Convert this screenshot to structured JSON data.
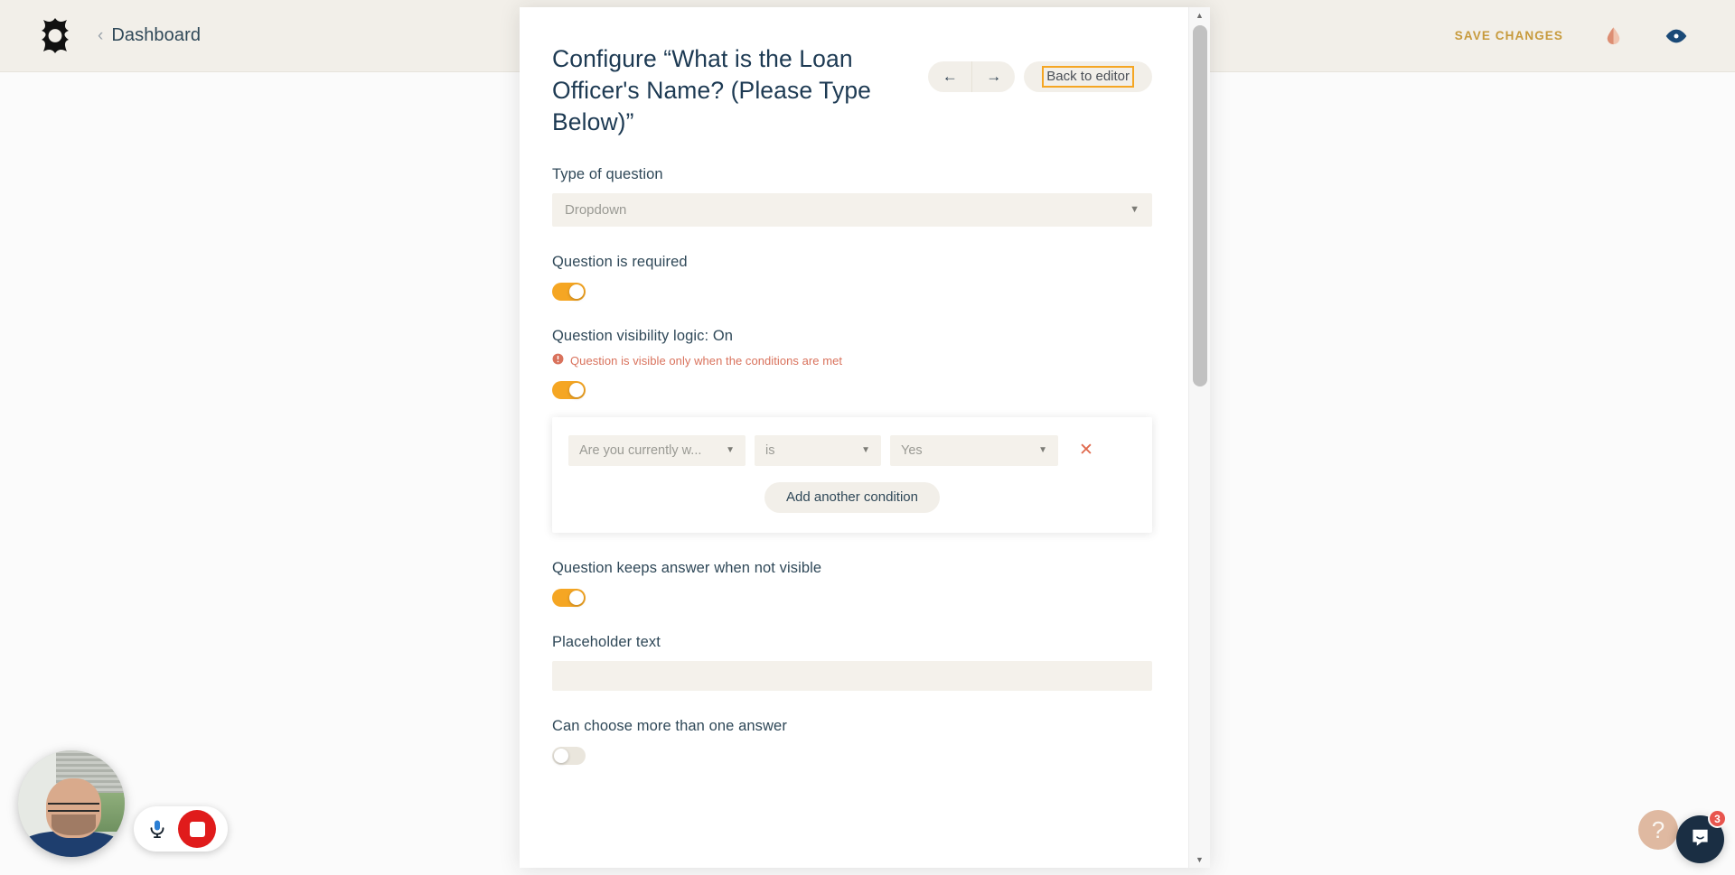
{
  "topbar": {
    "logo_icon": "app-logo-star",
    "breadcrumb_chevron": "‹",
    "breadcrumb_label": "Dashboard",
    "save_changes_label": "SAVE CHANGES",
    "theme_icon": "droplet-icon",
    "preview_icon": "eye-icon",
    "accent_gold": "#c79a3c",
    "droplet_color": "#e09e85",
    "eye_color": "#1b4a78"
  },
  "modal": {
    "title": "Configure “What is the Loan Officer's Name? (Please Type Below)”",
    "prev_arrow": "←",
    "next_arrow": "→",
    "back_to_editor_label": "Back to editor",
    "focus_outline_color": "#f5a623",
    "fields": {
      "type_of_question": {
        "label": "Type of question",
        "value": "Dropdown",
        "caret": "▼"
      },
      "question_required": {
        "label": "Question is required",
        "state": "on"
      },
      "visibility_logic": {
        "label": "Question visibility logic: On",
        "hint_icon": "info-icon",
        "hint": "Question is visible only when the conditions are met",
        "hint_color": "#d9725c",
        "state": "on"
      },
      "keeps_answer": {
        "label": "Question keeps answer when not visible",
        "state": "on"
      },
      "placeholder_text": {
        "label": "Placeholder text",
        "value": "",
        "placeholder": ""
      },
      "multi_answer": {
        "label": "Can choose more than one answer",
        "state": "off"
      }
    },
    "conditions": {
      "rows": [
        {
          "question": "Are you currently w...",
          "operator": "is",
          "value": "Yes",
          "remove_icon": "close-x-icon"
        }
      ],
      "add_condition_label": "Add another condition"
    },
    "scrollbar": {
      "up_arrow": "▲",
      "down_arrow": "▼"
    }
  },
  "recorder": {
    "mic_icon": "microphone-icon",
    "stop_icon": "stop-recording-icon",
    "avatar": "webcam-self-view"
  },
  "widgets": {
    "help_label": "?",
    "chat_icon": "intercom-chat-icon",
    "chat_badge_count": "3"
  },
  "toggle_colors": {
    "on": "#f5a623",
    "off": "#eae6dd"
  }
}
